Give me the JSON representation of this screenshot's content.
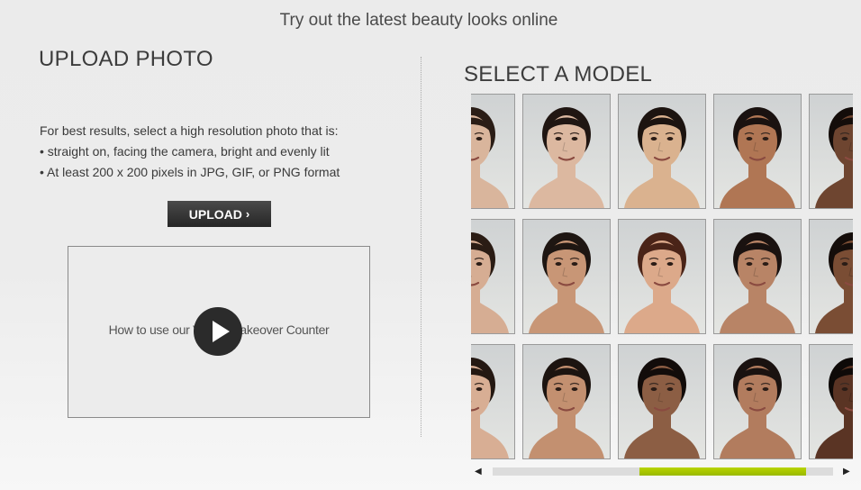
{
  "header": {
    "tagline": "Try out the latest beauty looks online"
  },
  "upload": {
    "title": "UPLOAD PHOTO",
    "intro": "For best results, select a high resolution photo that is:",
    "bullets": [
      "• straight on, facing the camera, bright and evenly lit",
      "• At least 200 x 200 pixels in JPG, GIF, or PNG format"
    ],
    "button_label": "UPLOAD",
    "button_chevron": "›",
    "video_caption": "How to use our Virtual Makeover Counter"
  },
  "models": {
    "title": "SELECT A MODEL",
    "skin_tones": [
      [
        "#d9b59c",
        "#dcb8a0",
        "#dab28f",
        "#b07654",
        "#6e4530"
      ],
      [
        "#d6ad93",
        "#c89676",
        "#dca98a",
        "#b88466",
        "#7a4d34"
      ],
      [
        "#d8ae94",
        "#c39070",
        "#8c5e44",
        "#b27c5e",
        "#5a3424"
      ]
    ],
    "hair_colors": [
      [
        "#2a1d16",
        "#201612",
        "#1c1410",
        "#1a1210",
        "#140d0a"
      ],
      [
        "#2a1c14",
        "#1e1612",
        "#4a2418",
        "#1a1210",
        "#140d0a"
      ],
      [
        "#241812",
        "#1c1410",
        "#120c0a",
        "#1a1210",
        "#0e0a08"
      ]
    ],
    "background": "#cfd2d3"
  },
  "scrollbar": {
    "left_arrow": "◀",
    "right_arrow": "▶",
    "thumb_start_fraction": 0.43,
    "thumb_end_fraction": 0.92,
    "thumb_color": "#a8c800"
  }
}
